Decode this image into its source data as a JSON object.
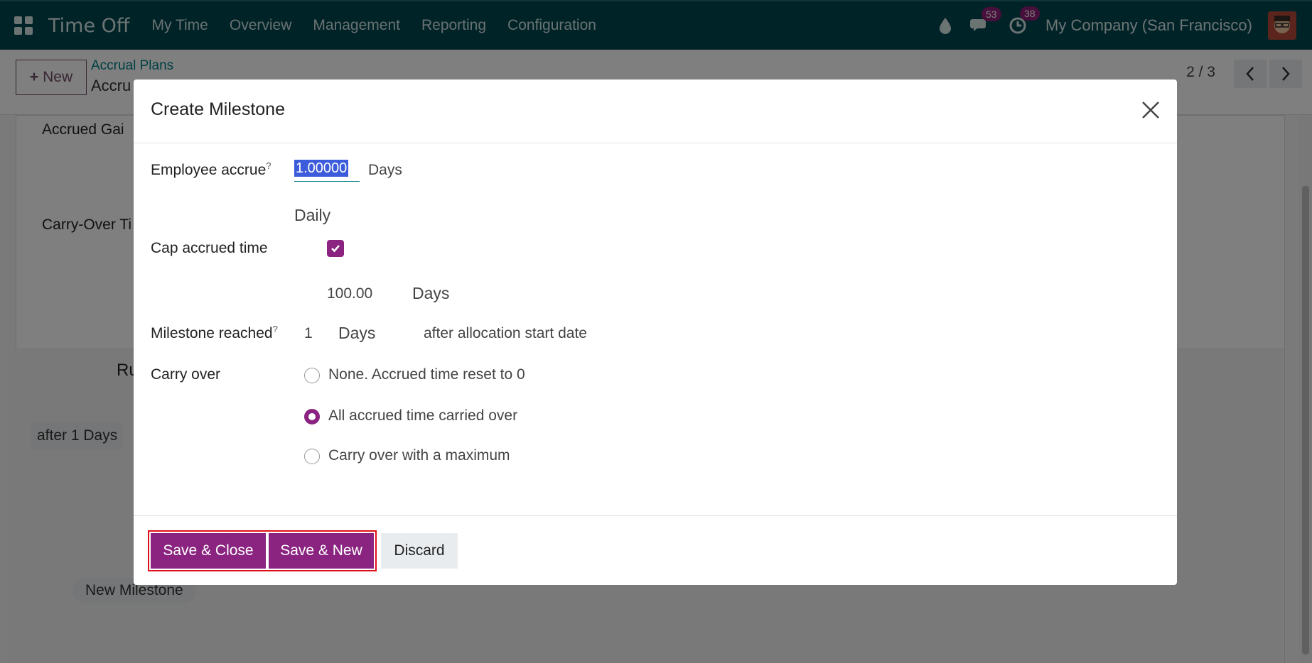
{
  "navbar": {
    "app_title": "Time Off",
    "menu": [
      "My Time",
      "Overview",
      "Management",
      "Reporting",
      "Configuration"
    ],
    "messages_badge": "53",
    "activities_badge": "38",
    "company": "My Company (San Francisco)"
  },
  "control_panel": {
    "new_label": "New",
    "breadcrumb": "Accrual Plans",
    "record_title": "Accru",
    "pager": "2 / 3"
  },
  "background": {
    "accrued_gain_label": "Accrued Gai",
    "carry_over_label": "Carry-Over Ti",
    "rules_label": "Ru",
    "milestone_pill": "after 1 Days",
    "new_milestone": "New Milestone"
  },
  "modal": {
    "title": "Create Milestone",
    "employee_accrue_label": "Employee accrue",
    "employee_accrue_help": "?",
    "accrue_amount": "1.00000",
    "accrue_unit": "Days",
    "frequency": "Daily",
    "cap_label": "Cap accrued time",
    "cap_checked": true,
    "cap_amount": "100.00",
    "cap_unit": "Days",
    "milestone_label": "Milestone reached",
    "milestone_help": "?",
    "milestone_value": "1",
    "milestone_unit": "Days",
    "milestone_suffix": "after allocation start date",
    "carry_over_label": "Carry over",
    "carry_options": [
      {
        "label": "None. Accrued time reset to 0",
        "checked": false
      },
      {
        "label": "All accrued time carried over",
        "checked": true
      },
      {
        "label": "Carry over with a maximum",
        "checked": false
      }
    ],
    "save_close_label": "Save & Close",
    "save_new_label": "Save & New",
    "discard_label": "Discard"
  },
  "colors": {
    "navbar": "#00474f",
    "primary": "#8a2480",
    "highlight_border": "#e0101a"
  }
}
